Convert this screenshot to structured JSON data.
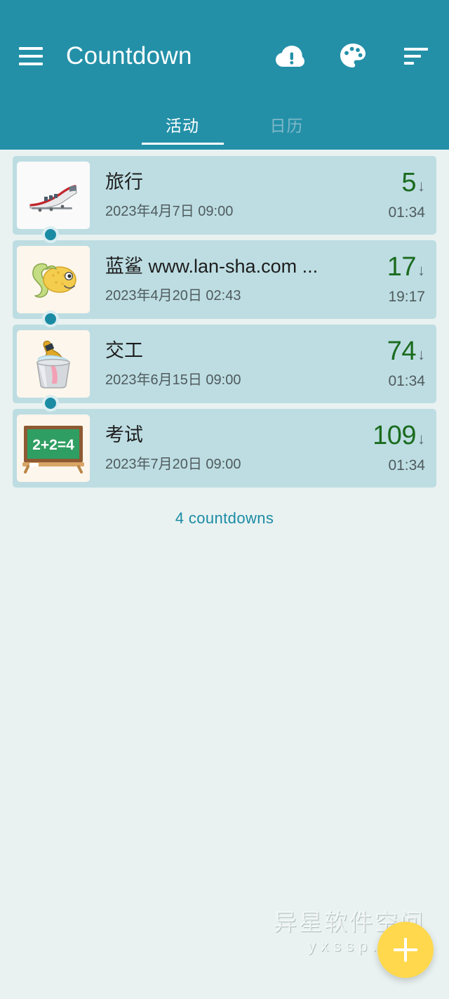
{
  "app": {
    "title": "Countdown",
    "theme_color": "#2390a8",
    "card_color": "#bddde2",
    "page_background": "#e9f2f1",
    "accent_green": "#1b6b1f",
    "fab_color": "#ffd84d"
  },
  "appbar": {
    "menu_icon": "hamburger-menu-icon",
    "actions": [
      {
        "name": "cloud-alert-icon",
        "label": ""
      },
      {
        "name": "palette-icon",
        "label": ""
      },
      {
        "name": "sort-icon",
        "label": ""
      }
    ]
  },
  "tabs": [
    {
      "label": "活动",
      "active": true
    },
    {
      "label": "日历",
      "active": false
    }
  ],
  "countdowns": [
    {
      "icon": "bullet-train-emoji",
      "title": "旅行",
      "datetime": "2023年4月7日 09:00",
      "days": "5",
      "direction": "↓",
      "time": "01:34"
    },
    {
      "icon": "tropical-fish-emoji",
      "title": "蓝鲨 www.lan-sha.com ...",
      "datetime": "2023年4月20日 02:43",
      "days": "17",
      "direction": "↓",
      "time": "19:17"
    },
    {
      "icon": "champagne-bucket-emoji",
      "title": "交工",
      "datetime": "2023年6月15日 09:00",
      "days": "74",
      "direction": "↓",
      "time": "01:34"
    },
    {
      "icon": "blackboard-emoji",
      "title": "考试",
      "datetime": "2023年7月20日 09:00",
      "days": "109",
      "direction": "↓",
      "time": "01:34"
    }
  ],
  "footer": {
    "count_label": "4 countdowns"
  },
  "watermark": {
    "line1": "异星软件空间",
    "line2": "yxssp.com"
  },
  "fab": {
    "label": "+",
    "name": "add-countdown-button"
  }
}
